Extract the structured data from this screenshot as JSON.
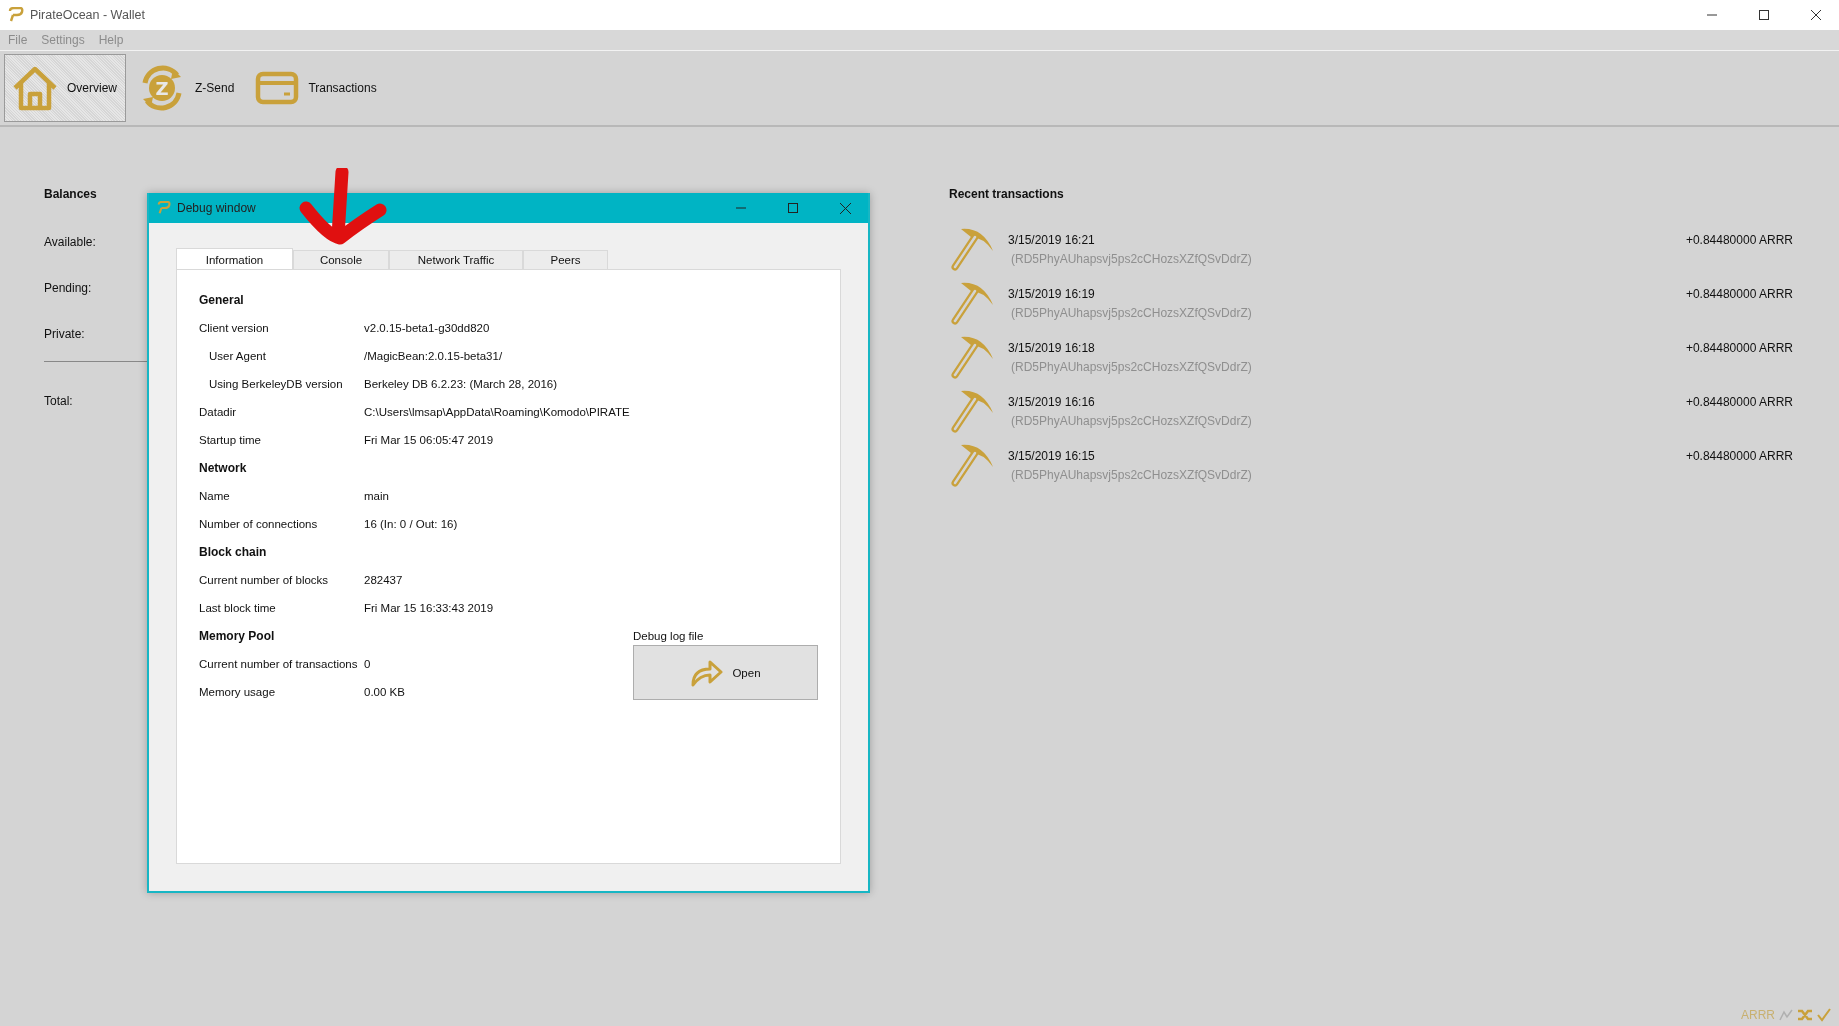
{
  "window": {
    "title": "PirateOcean - Wallet"
  },
  "menu": [
    "File",
    "Settings",
    "Help"
  ],
  "toolbar": [
    {
      "kind": "home",
      "label": "Overview",
      "selected": true
    },
    {
      "kind": "zsend",
      "label": "Z-Send",
      "icon_letter": "Z",
      "selected": false
    },
    {
      "kind": "card",
      "label": "Transactions",
      "selected": false
    }
  ],
  "balances": {
    "title": "Balances",
    "rows": [
      "Available:",
      "Pending:",
      "Private:"
    ],
    "total": "Total:"
  },
  "debug_window": {
    "title": "Debug window",
    "tabs": [
      {
        "label": "Information",
        "selected": true
      },
      {
        "label": "Console",
        "selected": false
      },
      {
        "label": "Network Traffic",
        "selected": false
      },
      {
        "label": "Peers",
        "selected": false
      }
    ],
    "sections": [
      {
        "heading": "General",
        "rows": [
          {
            "label": "Client version",
            "value": "v2.0.15-beta1-g30dd820",
            "children": [
              {
                "label": "User Agent",
                "value": "/MagicBean:2.0.15-beta31/"
              },
              {
                "label": "Using BerkeleyDB version",
                "value": "Berkeley DB 6.2.23: (March 28, 2016)"
              }
            ]
          },
          {
            "label": "Datadir",
            "value": "C:\\Users\\lmsap\\AppData\\Roaming\\Komodo\\PIRATE"
          },
          {
            "label": "Startup time",
            "value": "Fri Mar 15 06:05:47 2019"
          }
        ]
      },
      {
        "heading": "Network",
        "rows": [
          {
            "label": "Name",
            "value": "main"
          },
          {
            "label": "Number of connections",
            "value": "16 (In: 0 / Out: 16)"
          }
        ]
      },
      {
        "heading": "Block chain",
        "rows": [
          {
            "label": "Current number of blocks",
            "value": "282437"
          },
          {
            "label": "Last block time",
            "value": "Fri Mar 15 16:33:43 2019"
          }
        ]
      },
      {
        "heading": "Memory Pool",
        "rows": [
          {
            "label": "Current number of transactions",
            "value": "0"
          },
          {
            "label": "Memory usage",
            "value": "0.00 KB"
          }
        ]
      }
    ],
    "debug_log": {
      "label": "Debug log file",
      "button": "Open"
    }
  },
  "recent_transactions": {
    "title": "Recent transactions",
    "items": [
      {
        "time": "3/15/2019 16:21",
        "address": "(RD5PhyAUhapsvj5ps2cCHozsXZfQSvDdrZ)",
        "amount": "+0.84480000 ARRR"
      },
      {
        "time": "3/15/2019 16:19",
        "address": "(RD5PhyAUhapsvj5ps2cCHozsXZfQSvDdrZ)",
        "amount": "+0.84480000 ARRR"
      },
      {
        "time": "3/15/2019 16:18",
        "address": "(RD5PhyAUhapsvj5ps2cCHozsXZfQSvDdrZ)",
        "amount": "+0.84480000 ARRR"
      },
      {
        "time": "3/15/2019 16:16",
        "address": "(RD5PhyAUhapsvj5ps2cCHozsXZfQSvDdrZ)",
        "amount": "+0.84480000 ARRR"
      },
      {
        "time": "3/15/2019 16:15",
        "address": "(RD5PhyAUhapsvj5ps2cCHozsXZfQSvDdrZ)",
        "amount": "+0.84480000 ARRR"
      }
    ]
  },
  "status_bar": {
    "ticker": "ARRR"
  }
}
